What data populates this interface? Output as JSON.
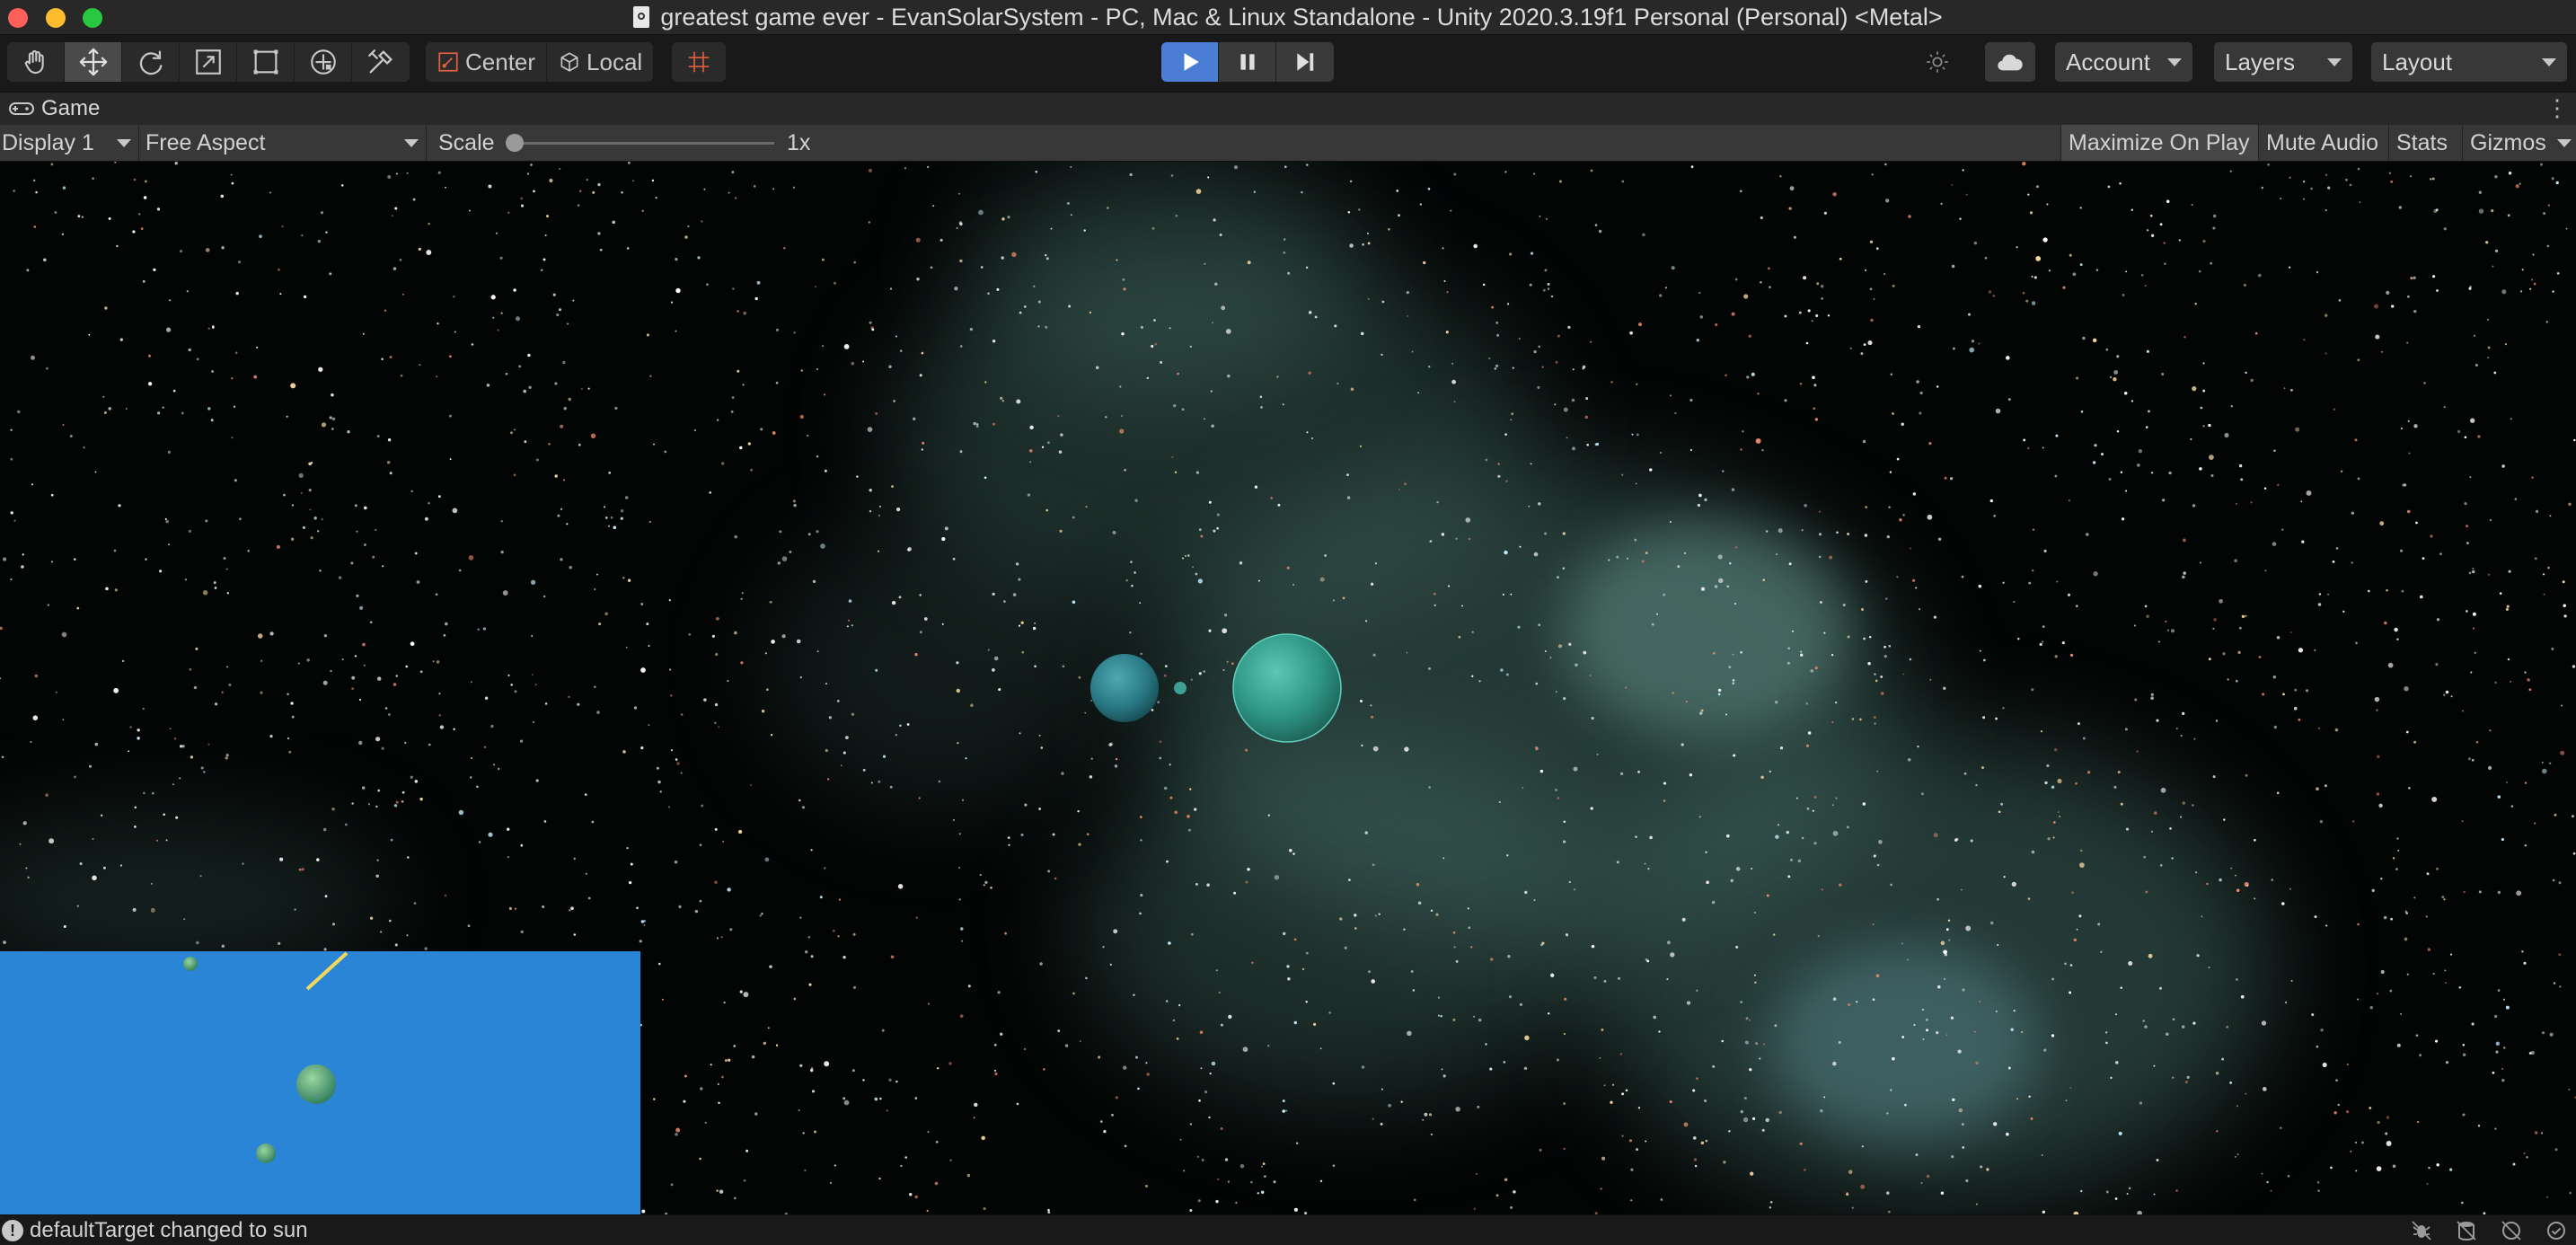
{
  "window": {
    "title": "greatest game ever - EvanSolarSystem - PC, Mac & Linux Standalone - Unity 2020.3.19f1 Personal (Personal) <Metal>"
  },
  "toolbar": {
    "tools": [
      {
        "name": "hand-tool",
        "icon": "hand-icon",
        "active": false
      },
      {
        "name": "move-tool",
        "icon": "move-icon",
        "active": true
      },
      {
        "name": "rotate-tool",
        "icon": "rotate-icon",
        "active": false
      },
      {
        "name": "scale-tool",
        "icon": "scale-icon",
        "active": false
      },
      {
        "name": "rect-tool",
        "icon": "rect-icon",
        "active": false
      },
      {
        "name": "transform-tool",
        "icon": "transform-icon",
        "active": false
      },
      {
        "name": "custom-tool",
        "icon": "tools-icon",
        "active": false
      }
    ],
    "pivot_mode": "Center",
    "pivot_rotation": "Local",
    "play_state": "playing",
    "account_label": "Account",
    "layers_label": "Layers",
    "layout_label": "Layout"
  },
  "game_tab": {
    "label": "Game",
    "display": "Display 1",
    "aspect": "Free Aspect",
    "scale_label": "Scale",
    "scale_value": "1x",
    "scale_fraction": 0.0,
    "buttons": [
      {
        "label": "Maximize On Play",
        "active": true
      },
      {
        "label": "Mute Audio",
        "active": false
      },
      {
        "label": "Stats",
        "active": false
      },
      {
        "label": "Gizmos",
        "active": false
      }
    ]
  },
  "status": {
    "message": "defaultTarget changed to sun"
  },
  "colors": {
    "accent": "#4c7dd4",
    "minimap_bg": "#2a85d6",
    "planet_teal": "#2f9f8e",
    "nebula": "#4e7a72"
  }
}
